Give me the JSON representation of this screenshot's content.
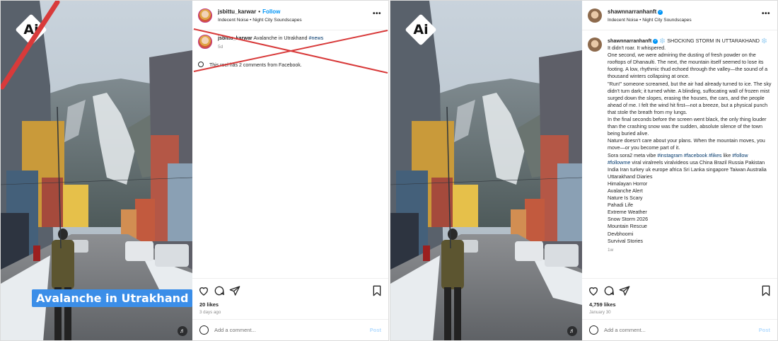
{
  "left_post": {
    "badge": "Ai",
    "video_caption": "Avalanche in Utrakhand",
    "username": "jsbittu_karwar",
    "follow_label": "Follow",
    "audio": "Indecent Noise • Night City Soundscapes",
    "caption_user": "jsbittu_karwar",
    "caption_text": "Avalanche in Utrakhand",
    "caption_tag": "#news",
    "caption_time": "5d",
    "comments_note": "This reel has 2 comments from Facebook.",
    "likes": "20 likes",
    "date": "3 days ago",
    "comment_placeholder": "Add a comment...",
    "post_label": "Post",
    "strike_color": "#d83a3a"
  },
  "right_post": {
    "badge": "Ai",
    "username": "shawnnarranhanft",
    "audio": "Indecent Noise • Night City Soundscapes",
    "caption_user": "shawnnarranhanft",
    "caption_title": "❄️ SHOCKING STORM IN UTTARAKHAND ❄️",
    "caption_lines": [
      "It didn't roar. It whispered.",
      "One second, we were admiring the dusting of fresh powder on the rooftops of Dhanaulti. The next, the mountain itself seemed to lose its footing. A low, rhythmic thud echoed through the valley—the sound of a thousand winters collapsing at once.",
      "\"Run!\" someone screamed, but the air had already turned to ice. The sky didn't turn dark; it turned white. A blinding, suffocating wall of frozen mist surged down the slopes, erasing the houses, the cars, and the people ahead of me. I felt the wind hit first—not a breeze, but a physical punch that stole the breath from my lungs.",
      "In the final seconds before the screen went black, the only thing louder than the crashing snow was the sudden, absolute silence of the town being buried alive.",
      "Nature doesn't care about your plans. When the mountain moves, you move—or you become part of it."
    ],
    "hashtag_line_start": "Sora sora2 meta vibe",
    "hashtag_1": "#instagram",
    "hashtag_2": "#facebook",
    "hashtag_3": "#likes",
    "hashtag_like": "like",
    "hashtag_4": "#follow",
    "hashtag_5": "#followme",
    "hashtag_line_end": "viral viralreels viralvideos usa China Brazil Russia Pakistan India Iran turkey uk europe africa Sri Lanka singapore Taiwan Australia",
    "topics": [
      "Uttarakhand Diaries",
      "Himalayan Horror",
      "Avalanche Alert",
      "Nature Is Scary",
      "Pahadi Life",
      "Extreme Weather",
      "Snow Storm 2026",
      "Mountain Rescue",
      "Devbhoomi",
      "Survival Stories"
    ],
    "caption_time": "1w",
    "likes": "4,759 likes",
    "date": "January 30",
    "comment_placeholder": "Add a comment...",
    "post_label": "Post"
  },
  "colors": {
    "link_blue": "#0095f6",
    "hashtag_blue": "#00376b",
    "banner_blue": "#3b8ee8"
  }
}
